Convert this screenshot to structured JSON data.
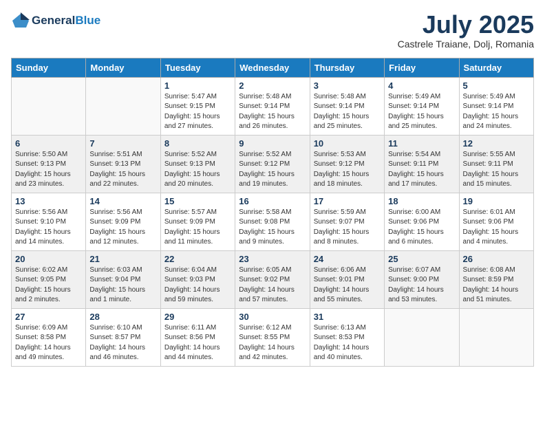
{
  "header": {
    "logo_general": "General",
    "logo_blue": "Blue",
    "month_year": "July 2025",
    "location": "Castrele Traiane, Dolj, Romania"
  },
  "weekdays": [
    "Sunday",
    "Monday",
    "Tuesday",
    "Wednesday",
    "Thursday",
    "Friday",
    "Saturday"
  ],
  "weeks": [
    [
      {
        "day": "",
        "sunrise": "",
        "sunset": "",
        "daylight": ""
      },
      {
        "day": "",
        "sunrise": "",
        "sunset": "",
        "daylight": ""
      },
      {
        "day": "1",
        "sunrise": "Sunrise: 5:47 AM",
        "sunset": "Sunset: 9:15 PM",
        "daylight": "Daylight: 15 hours and 27 minutes."
      },
      {
        "day": "2",
        "sunrise": "Sunrise: 5:48 AM",
        "sunset": "Sunset: 9:14 PM",
        "daylight": "Daylight: 15 hours and 26 minutes."
      },
      {
        "day": "3",
        "sunrise": "Sunrise: 5:48 AM",
        "sunset": "Sunset: 9:14 PM",
        "daylight": "Daylight: 15 hours and 25 minutes."
      },
      {
        "day": "4",
        "sunrise": "Sunrise: 5:49 AM",
        "sunset": "Sunset: 9:14 PM",
        "daylight": "Daylight: 15 hours and 25 minutes."
      },
      {
        "day": "5",
        "sunrise": "Sunrise: 5:49 AM",
        "sunset": "Sunset: 9:14 PM",
        "daylight": "Daylight: 15 hours and 24 minutes."
      }
    ],
    [
      {
        "day": "6",
        "sunrise": "Sunrise: 5:50 AM",
        "sunset": "Sunset: 9:13 PM",
        "daylight": "Daylight: 15 hours and 23 minutes."
      },
      {
        "day": "7",
        "sunrise": "Sunrise: 5:51 AM",
        "sunset": "Sunset: 9:13 PM",
        "daylight": "Daylight: 15 hours and 22 minutes."
      },
      {
        "day": "8",
        "sunrise": "Sunrise: 5:52 AM",
        "sunset": "Sunset: 9:13 PM",
        "daylight": "Daylight: 15 hours and 20 minutes."
      },
      {
        "day": "9",
        "sunrise": "Sunrise: 5:52 AM",
        "sunset": "Sunset: 9:12 PM",
        "daylight": "Daylight: 15 hours and 19 minutes."
      },
      {
        "day": "10",
        "sunrise": "Sunrise: 5:53 AM",
        "sunset": "Sunset: 9:12 PM",
        "daylight": "Daylight: 15 hours and 18 minutes."
      },
      {
        "day": "11",
        "sunrise": "Sunrise: 5:54 AM",
        "sunset": "Sunset: 9:11 PM",
        "daylight": "Daylight: 15 hours and 17 minutes."
      },
      {
        "day": "12",
        "sunrise": "Sunrise: 5:55 AM",
        "sunset": "Sunset: 9:11 PM",
        "daylight": "Daylight: 15 hours and 15 minutes."
      }
    ],
    [
      {
        "day": "13",
        "sunrise": "Sunrise: 5:56 AM",
        "sunset": "Sunset: 9:10 PM",
        "daylight": "Daylight: 15 hours and 14 minutes."
      },
      {
        "day": "14",
        "sunrise": "Sunrise: 5:56 AM",
        "sunset": "Sunset: 9:09 PM",
        "daylight": "Daylight: 15 hours and 12 minutes."
      },
      {
        "day": "15",
        "sunrise": "Sunrise: 5:57 AM",
        "sunset": "Sunset: 9:09 PM",
        "daylight": "Daylight: 15 hours and 11 minutes."
      },
      {
        "day": "16",
        "sunrise": "Sunrise: 5:58 AM",
        "sunset": "Sunset: 9:08 PM",
        "daylight": "Daylight: 15 hours and 9 minutes."
      },
      {
        "day": "17",
        "sunrise": "Sunrise: 5:59 AM",
        "sunset": "Sunset: 9:07 PM",
        "daylight": "Daylight: 15 hours and 8 minutes."
      },
      {
        "day": "18",
        "sunrise": "Sunrise: 6:00 AM",
        "sunset": "Sunset: 9:06 PM",
        "daylight": "Daylight: 15 hours and 6 minutes."
      },
      {
        "day": "19",
        "sunrise": "Sunrise: 6:01 AM",
        "sunset": "Sunset: 9:06 PM",
        "daylight": "Daylight: 15 hours and 4 minutes."
      }
    ],
    [
      {
        "day": "20",
        "sunrise": "Sunrise: 6:02 AM",
        "sunset": "Sunset: 9:05 PM",
        "daylight": "Daylight: 15 hours and 2 minutes."
      },
      {
        "day": "21",
        "sunrise": "Sunrise: 6:03 AM",
        "sunset": "Sunset: 9:04 PM",
        "daylight": "Daylight: 15 hours and 1 minute."
      },
      {
        "day": "22",
        "sunrise": "Sunrise: 6:04 AM",
        "sunset": "Sunset: 9:03 PM",
        "daylight": "Daylight: 14 hours and 59 minutes."
      },
      {
        "day": "23",
        "sunrise": "Sunrise: 6:05 AM",
        "sunset": "Sunset: 9:02 PM",
        "daylight": "Daylight: 14 hours and 57 minutes."
      },
      {
        "day": "24",
        "sunrise": "Sunrise: 6:06 AM",
        "sunset": "Sunset: 9:01 PM",
        "daylight": "Daylight: 14 hours and 55 minutes."
      },
      {
        "day": "25",
        "sunrise": "Sunrise: 6:07 AM",
        "sunset": "Sunset: 9:00 PM",
        "daylight": "Daylight: 14 hours and 53 minutes."
      },
      {
        "day": "26",
        "sunrise": "Sunrise: 6:08 AM",
        "sunset": "Sunset: 8:59 PM",
        "daylight": "Daylight: 14 hours and 51 minutes."
      }
    ],
    [
      {
        "day": "27",
        "sunrise": "Sunrise: 6:09 AM",
        "sunset": "Sunset: 8:58 PM",
        "daylight": "Daylight: 14 hours and 49 minutes."
      },
      {
        "day": "28",
        "sunrise": "Sunrise: 6:10 AM",
        "sunset": "Sunset: 8:57 PM",
        "daylight": "Daylight: 14 hours and 46 minutes."
      },
      {
        "day": "29",
        "sunrise": "Sunrise: 6:11 AM",
        "sunset": "Sunset: 8:56 PM",
        "daylight": "Daylight: 14 hours and 44 minutes."
      },
      {
        "day": "30",
        "sunrise": "Sunrise: 6:12 AM",
        "sunset": "Sunset: 8:55 PM",
        "daylight": "Daylight: 14 hours and 42 minutes."
      },
      {
        "day": "31",
        "sunrise": "Sunrise: 6:13 AM",
        "sunset": "Sunset: 8:53 PM",
        "daylight": "Daylight: 14 hours and 40 minutes."
      },
      {
        "day": "",
        "sunrise": "",
        "sunset": "",
        "daylight": ""
      },
      {
        "day": "",
        "sunrise": "",
        "sunset": "",
        "daylight": ""
      }
    ]
  ]
}
